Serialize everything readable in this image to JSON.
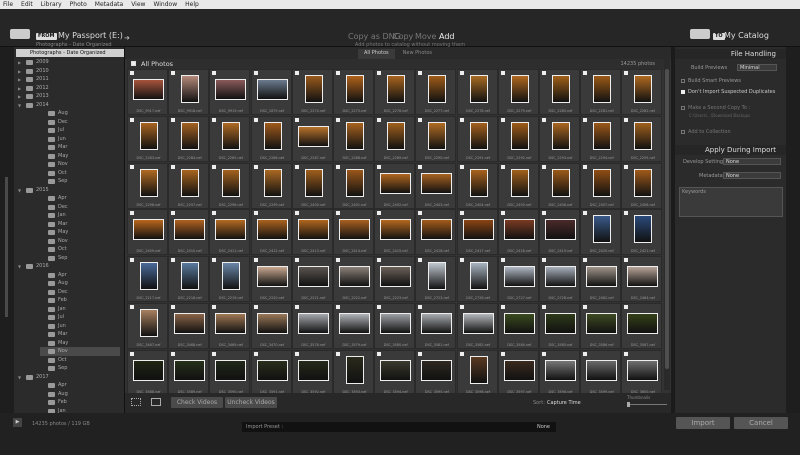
{
  "menu": [
    "File",
    "Edit",
    "Library",
    "Photo",
    "Metadata",
    "View",
    "Window",
    "Help"
  ],
  "top": {
    "from_badge": "FROM",
    "source_title": "My Passport (E:)",
    "source_sub": "Photographs - Date Organized",
    "modes": [
      "Copy as DNG",
      "Copy",
      "Move",
      "Add"
    ],
    "active_mode": "Add",
    "mode_sub": "Add photos to catalog without moving them",
    "to_badge": "TO",
    "dest_title": "My Catalog"
  },
  "tree": {
    "root": "Photographs - Date Organized",
    "rows": [
      {
        "label": "2009",
        "level": 1
      },
      {
        "label": "2010",
        "level": 1
      },
      {
        "label": "2011",
        "level": 1
      },
      {
        "label": "2012",
        "level": 1
      },
      {
        "label": "2013",
        "level": 1
      },
      {
        "label": "2014",
        "level": 1,
        "open": true
      },
      {
        "label": "Aug",
        "level": 2
      },
      {
        "label": "Dec",
        "level": 2
      },
      {
        "label": "Jul",
        "level": 2
      },
      {
        "label": "Jun",
        "level": 2
      },
      {
        "label": "Mar",
        "level": 2
      },
      {
        "label": "May",
        "level": 2
      },
      {
        "label": "Nov",
        "level": 2
      },
      {
        "label": "Oct",
        "level": 2
      },
      {
        "label": "Sep",
        "level": 2
      },
      {
        "label": "2015",
        "level": 1,
        "open": true
      },
      {
        "label": "Apr",
        "level": 2
      },
      {
        "label": "Dec",
        "level": 2
      },
      {
        "label": "Jan",
        "level": 2
      },
      {
        "label": "Mar",
        "level": 2
      },
      {
        "label": "May",
        "level": 2
      },
      {
        "label": "Nov",
        "level": 2
      },
      {
        "label": "Oct",
        "level": 2
      },
      {
        "label": "Sep",
        "level": 2
      },
      {
        "label": "2016",
        "level": 1,
        "open": true
      },
      {
        "label": "Apr",
        "level": 2
      },
      {
        "label": "Aug",
        "level": 2
      },
      {
        "label": "Dec",
        "level": 2
      },
      {
        "label": "Feb",
        "level": 2
      },
      {
        "label": "Jan",
        "level": 2
      },
      {
        "label": "Jul",
        "level": 2
      },
      {
        "label": "Jun",
        "level": 2
      },
      {
        "label": "Mar",
        "level": 2
      },
      {
        "label": "May",
        "level": 2
      },
      {
        "label": "Nov",
        "level": 2,
        "selected": true
      },
      {
        "label": "Oct",
        "level": 2
      },
      {
        "label": "Sep",
        "level": 2
      },
      {
        "label": "2017",
        "level": 1,
        "open": true
      },
      {
        "label": "Apr",
        "level": 2
      },
      {
        "label": "Aug",
        "level": 2
      },
      {
        "label": "Feb",
        "level": 2
      },
      {
        "label": "Jan",
        "level": 2
      }
    ]
  },
  "center": {
    "tabs": [
      "All Photos",
      "New Photos"
    ],
    "active_tab": "All Photos",
    "header": "All Photos",
    "count": "14235 photos",
    "check_videos": "Check Videos",
    "uncheck_videos": "Uncheck Videos",
    "sort_label": "Sort:",
    "sort_value": "Capture Time",
    "thumbnails_label": "Thumbnails"
  },
  "photos": [
    {
      "name": "DSC_9917.nef",
      "o": "l",
      "c": "#a8543c"
    },
    {
      "name": "DSC_9918.nef",
      "o": "p",
      "c": "#b58a7a"
    },
    {
      "name": "DSC_9919.nef",
      "o": "l",
      "c": "#8a5a5a"
    },
    {
      "name": "DSC_1879.nef",
      "o": "l",
      "c": "#6b7b8e"
    },
    {
      "name": "DSC_2274.nef",
      "o": "p",
      "c": "#9a5a1c"
    },
    {
      "name": "DSC_2275.nef",
      "o": "p",
      "c": "#b0621a"
    },
    {
      "name": "DSC_2276.nef",
      "o": "p",
      "c": "#a8641e"
    },
    {
      "name": "DSC_2277.nef",
      "o": "p",
      "c": "#a05c18"
    },
    {
      "name": "DSC_2278.nef",
      "o": "p",
      "c": "#a86a22"
    },
    {
      "name": "DSC_2279.nef",
      "o": "p",
      "c": "#b06820"
    },
    {
      "name": "DSC_2280.nef",
      "o": "p",
      "c": "#a06018"
    },
    {
      "name": "DSC_2281.nef",
      "o": "p",
      "c": "#9c5a16"
    },
    {
      "name": "DSC_2282.nef",
      "o": "p",
      "c": "#b06a20"
    },
    {
      "name": "DSC_2283.nef",
      "o": "p",
      "c": "#a86420"
    },
    {
      "name": "DSC_2284.nef",
      "o": "p",
      "c": "#a46222"
    },
    {
      "name": "DSC_2285.nef",
      "o": "p",
      "c": "#b06a24"
    },
    {
      "name": "DSC_2286.nef",
      "o": "p",
      "c": "#a05a1c"
    },
    {
      "name": "DSC_2287.nef",
      "o": "l",
      "c": "#b8722a"
    },
    {
      "name": "DSC_2288.nef",
      "o": "p",
      "c": "#a8621e"
    },
    {
      "name": "DSC_2289.nef",
      "o": "p",
      "c": "#a0601c"
    },
    {
      "name": "DSC_2290.nef",
      "o": "p",
      "c": "#b06c24"
    },
    {
      "name": "DSC_2291.nef",
      "o": "p",
      "c": "#a4601e"
    },
    {
      "name": "DSC_2292.nef",
      "o": "p",
      "c": "#a05c1a"
    },
    {
      "name": "DSC_2293.nef",
      "o": "p",
      "c": "#aa6620"
    },
    {
      "name": "DSC_2294.nef",
      "o": "p",
      "c": "#9c5818"
    },
    {
      "name": "DSC_2295.nef",
      "o": "p",
      "c": "#a0601c"
    },
    {
      "name": "DSC_2296.nef",
      "o": "p",
      "c": "#b06a22"
    },
    {
      "name": "DSC_2297.nef",
      "o": "p",
      "c": "#a8641e"
    },
    {
      "name": "DSC_2298.nef",
      "o": "p",
      "c": "#a4621e"
    },
    {
      "name": "DSC_2299.nef",
      "o": "p",
      "c": "#aa6822"
    },
    {
      "name": "DSC_2400.nef",
      "o": "p",
      "c": "#a05e1c"
    },
    {
      "name": "DSC_2401.nef",
      "o": "p",
      "c": "#9a561a"
    },
    {
      "name": "DSC_2402.nef",
      "o": "l",
      "c": "#b0661e"
    },
    {
      "name": "DSC_2403.nef",
      "o": "l",
      "c": "#a86220"
    },
    {
      "name": "DSC_2404.nef",
      "o": "p",
      "c": "#a8621e"
    },
    {
      "name": "DSC_2405.nef",
      "o": "p",
      "c": "#a0601c"
    },
    {
      "name": "DSC_2406.nef",
      "o": "p",
      "c": "#9c5a18"
    },
    {
      "name": "DSC_2407.nef",
      "o": "p",
      "c": "#904e14"
    },
    {
      "name": "DSC_2408.nef",
      "o": "p",
      "c": "#a05a1a"
    },
    {
      "name": "DSC_2409.nef",
      "o": "l",
      "c": "#b8661c"
    },
    {
      "name": "DSC_2410.nef",
      "o": "l",
      "c": "#b06220"
    },
    {
      "name": "DSC_2411.nef",
      "o": "l",
      "c": "#b46a22"
    },
    {
      "name": "DSC_2412.nef",
      "o": "l",
      "c": "#aa621e"
    },
    {
      "name": "DSC_2413.nef",
      "o": "l",
      "c": "#b0661e"
    },
    {
      "name": "DSC_2414.nef",
      "o": "l",
      "c": "#a86020"
    },
    {
      "name": "DSC_2415.nef",
      "o": "l",
      "c": "#b4681e"
    },
    {
      "name": "DSC_2416.nef",
      "o": "l",
      "c": "#a45c1a"
    },
    {
      "name": "DSC_2417.nef",
      "o": "l",
      "c": "#8a4414"
    },
    {
      "name": "DSC_2418.nef",
      "o": "l",
      "c": "#7a3a22"
    },
    {
      "name": "DSC_2419.nef",
      "o": "l",
      "c": "#4a2a2a"
    },
    {
      "name": "DSC_2420.nef",
      "o": "p",
      "c": "#3a5a8a"
    },
    {
      "name": "DSC_2421.nef",
      "o": "p",
      "c": "#2a4a7a"
    },
    {
      "name": "DSC_2217.nef",
      "o": "p",
      "c": "#4a6a9a"
    },
    {
      "name": "DSC_2218.nef",
      "o": "p",
      "c": "#5a7aa0"
    },
    {
      "name": "DSC_2219.nef",
      "o": "p",
      "c": "#6a86a8"
    },
    {
      "name": "DSC_2220.nef",
      "o": "l",
      "c": "#c8a890"
    },
    {
      "name": "DSC_2221.nef",
      "o": "l",
      "c": "#5a5450"
    },
    {
      "name": "DSC_2222.nef",
      "o": "l",
      "c": "#8a8078"
    },
    {
      "name": "DSC_2223.nef",
      "o": "l",
      "c": "#6a6058"
    },
    {
      "name": "DSC_2723.nef",
      "o": "p",
      "c": "#c0c8d0"
    },
    {
      "name": "DSC_2726.nef",
      "o": "p",
      "c": "#a8b4c0"
    },
    {
      "name": "DSC_2727.nef",
      "o": "l",
      "c": "#b0b8c4"
    },
    {
      "name": "DSC_2728.nef",
      "o": "l",
      "c": "#a8b0bc"
    },
    {
      "name": "DSC_2462.nef",
      "o": "l",
      "c": "#a0948a"
    },
    {
      "name": "DSC_2464.nef",
      "o": "l",
      "c": "#b8a498"
    },
    {
      "name": "DSC_3467.nef",
      "o": "p",
      "c": "#a88060"
    },
    {
      "name": "DSC_3468.nef",
      "o": "l",
      "c": "#8a6448"
    },
    {
      "name": "DSC_3469.nef",
      "o": "l",
      "c": "#a07854"
    },
    {
      "name": "DSC_3470.nef",
      "o": "l",
      "c": "#9a7858"
    },
    {
      "name": "DSC_3578.nef",
      "o": "l",
      "c": "#a4a8ac"
    },
    {
      "name": "DSC_3579.nef",
      "o": "l",
      "c": "#b0b4b8"
    },
    {
      "name": "DSC_3580.nef",
      "o": "l",
      "c": "#9ca0a4"
    },
    {
      "name": "DSC_3581.nef",
      "o": "l",
      "c": "#a8acb0"
    },
    {
      "name": "DSC_3582.nef",
      "o": "l",
      "c": "#b4b8bc"
    },
    {
      "name": "DSC_3584.nef",
      "o": "l",
      "c": "#3a4a1e"
    },
    {
      "name": "DSC_3585.nef",
      "o": "l",
      "c": "#2e3a18"
    },
    {
      "name": "DSC_3586.nef",
      "o": "l",
      "c": "#3e4a22"
    },
    {
      "name": "DSC_3587.nef",
      "o": "l",
      "c": "#344018"
    },
    {
      "name": "DSC_3588.nef",
      "o": "l",
      "c": "#1e2412"
    },
    {
      "name": "DSC_3589.nef",
      "o": "l",
      "c": "#26301a"
    },
    {
      "name": "DSC_3590.nef",
      "o": "l",
      "c": "#20281a"
    },
    {
      "name": "DSC_3591.nef",
      "o": "l",
      "c": "#2a2e1c"
    },
    {
      "name": "DSC_3592.nef",
      "o": "l",
      "c": "#262a1a"
    },
    {
      "name": "DSC_3593.nef",
      "o": "p",
      "c": "#2a2a1c"
    },
    {
      "name": "DSC_3594.nef",
      "o": "l",
      "c": "#3a3a2e"
    },
    {
      "name": "DSC_3595.nef",
      "o": "l",
      "c": "#2e2820"
    },
    {
      "name": "DSC_3596.nef",
      "o": "p",
      "c": "#5a3a22"
    },
    {
      "name": "DSC_3597.nef",
      "o": "l",
      "c": "#3a2a1e"
    },
    {
      "name": "DSC_3598.nef",
      "o": "l",
      "c": "#777777"
    },
    {
      "name": "DSC_3599.nef",
      "o": "l",
      "c": "#6a6a6a"
    },
    {
      "name": "DSC_3600.nef",
      "o": "l",
      "c": "#707070"
    }
  ],
  "right": {
    "file_handling": "File Handling",
    "build_previews_label": "Build Previews",
    "build_previews_value": "Minimal",
    "build_smart": "Build Smart Previews",
    "dont_import": "Don't Import Suspected Duplicates",
    "make_second": "Make a Second Copy To :",
    "second_path": "C:\\Users\\...\\Download Backups",
    "add_collection": "Add to Collection",
    "apply_during": "Apply During Import",
    "develop_label": "Develop Settings",
    "develop_value": "None",
    "metadata_label": "Metadata",
    "metadata_value": "None",
    "keywords_label": "Keywords"
  },
  "bottom": {
    "status": "14235 photos / 119 GB",
    "preset_label": "Import Preset :",
    "preset_value": "None",
    "import_button": "Import",
    "cancel_button": "Cancel"
  }
}
